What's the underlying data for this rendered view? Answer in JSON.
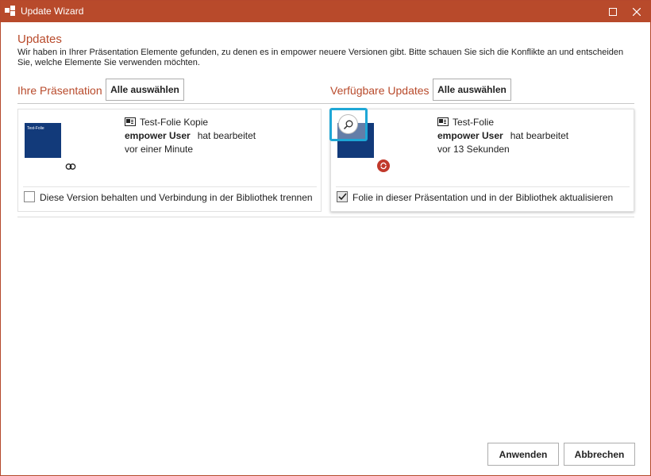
{
  "window": {
    "title": "Update Wizard"
  },
  "heading": "Updates",
  "intro": "Wir haben in Ihrer Präsentation Elemente gefunden, zu denen es in empower neuere Versionen gibt. Bitte schauen Sie sich die Konflikte an und entscheiden Sie, welche Elemente Sie verwenden möchten.",
  "left": {
    "title": "Ihre Präsentation",
    "select_all": "Alle auswählen",
    "card": {
      "thumb_text": "Test-Folie",
      "slide_name": "Test-Folie Kopie",
      "user": "empower User",
      "action": "hat bearbeitet",
      "time": "vor einer Minute",
      "checkbox_label": "Diese Version behalten und Verbindung in der Bibliothek trennen",
      "checked": false
    }
  },
  "right": {
    "title": "Verfügbare Updates",
    "select_all": "Alle auswählen",
    "card": {
      "slide_name": "Test-Folie",
      "user": "empower User",
      "action": "hat bearbeitet",
      "time": "vor 13 Sekunden",
      "checkbox_label": "Folie in dieser Präsentation und in der Bibliothek aktualisieren",
      "checked": true
    }
  },
  "footer": {
    "apply": "Anwenden",
    "cancel": "Abbrechen"
  },
  "colors": {
    "accent": "#b84a2b",
    "highlight": "#1ea7d6",
    "thumb": "#123a7a"
  },
  "icons": [
    "app-icon",
    "maximize-icon",
    "close-icon",
    "slide-icon",
    "link-icon",
    "zoom-icon",
    "update-badge-icon",
    "checkmark-icon"
  ]
}
